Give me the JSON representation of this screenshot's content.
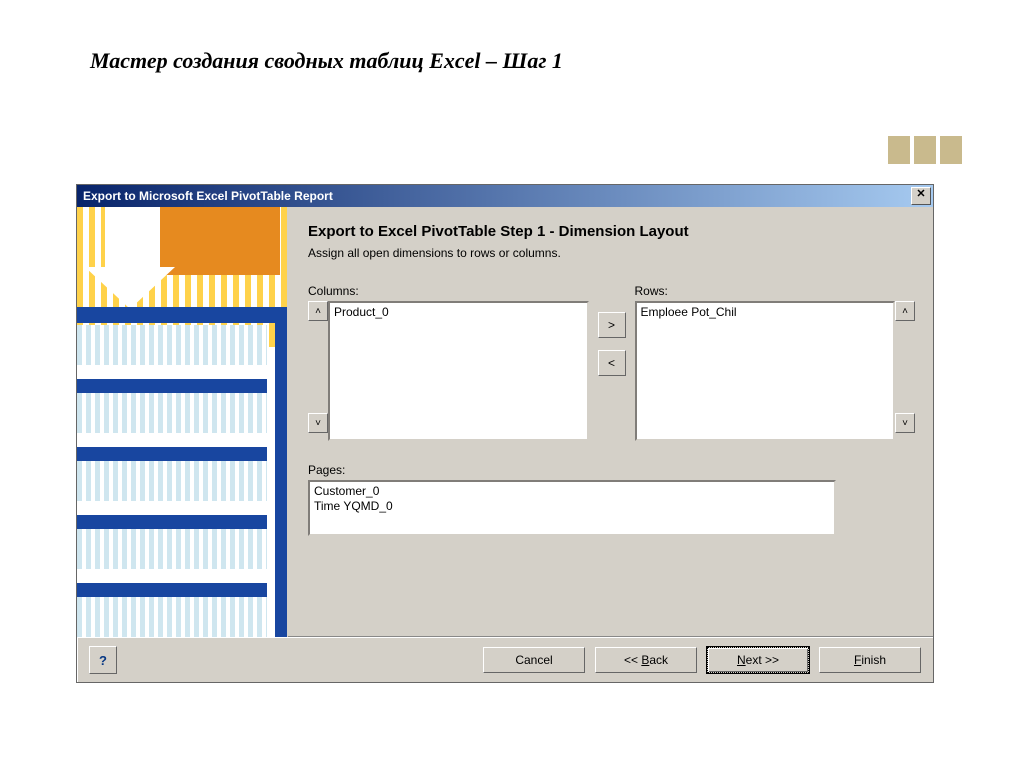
{
  "page": {
    "title": "Мастер создания сводных таблиц Excel – Шаг 1"
  },
  "dialog": {
    "title": "Export to Microsoft Excel PivotTable Report",
    "step_title": "Export to Excel PivotTable Step 1 - Dimension Layout",
    "step_desc": "Assign all open dimensions to rows or columns.",
    "columns_label": "Columns:",
    "rows_label": "Rows:",
    "pages_label": "Pages:",
    "columns_items": [
      "Product_0"
    ],
    "rows_items": [
      "Emploee Pot_Chil"
    ],
    "pages_items": [
      "Customer_0",
      "Time YQMD_0"
    ],
    "move_right": ">",
    "move_left": "<",
    "buttons": {
      "help": "?",
      "cancel": "Cancel",
      "back": "<< Back",
      "next": "Next >>",
      "finish": "Finish"
    },
    "scroll": {
      "up": "˄",
      "down": "˅"
    }
  }
}
